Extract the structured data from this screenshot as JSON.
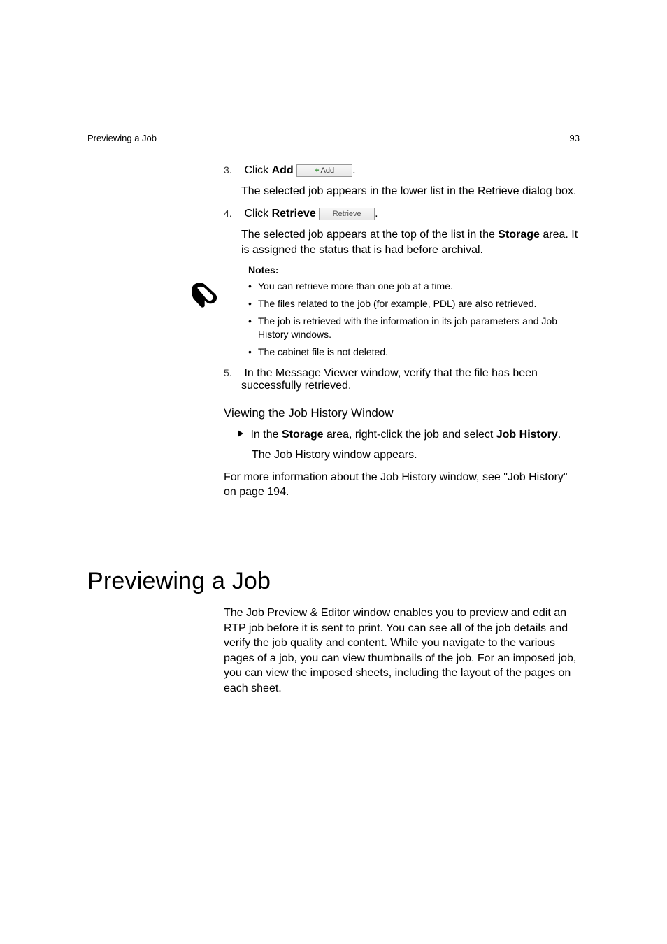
{
  "header": {
    "left": "Previewing a Job",
    "right": "93"
  },
  "steps": {
    "s3": {
      "num": "3.",
      "pre": "Click ",
      "bold": "Add",
      "btn_plus": "+",
      "btn_label": "Add",
      "post": ".",
      "cont": "The selected job appears in the lower list in the Retrieve dialog box."
    },
    "s4": {
      "num": "4.",
      "pre": "Click ",
      "bold": "Retrieve",
      "btn_label": "Retrieve",
      "post": ".",
      "cont_a": "The selected job appears at the top of the list in the ",
      "cont_bold": "Storage",
      "cont_b": " area. It is assigned the status that is had before archival."
    },
    "s5": {
      "num": "5.",
      "text": "In the Message Viewer window, verify that the file has been successfully retrieved."
    }
  },
  "notes": {
    "title": "Notes:",
    "items": [
      "You can retrieve more than one job at a time.",
      "The files related to the job (for example, PDL) are also retrieved.",
      "The job is retrieved with the information in its job parameters and Job History windows.",
      "The cabinet file is not deleted."
    ]
  },
  "viewing": {
    "heading": "Viewing the Job History Window",
    "line_a": "In the ",
    "bold1": "Storage",
    "line_b": " area, right-click the job and select ",
    "bold2": "Job History",
    "line_c": ".",
    "result": "The Job History window appears.",
    "more": "For more information about the Job History window, see \"Job History\" on page 194."
  },
  "section": {
    "title": "Previewing a Job",
    "para": "The Job Preview & Editor window enables you to preview and edit an RTP job before it is sent to print. You can see all of the job details and verify the job quality and content. While you navigate to the various pages of a job, you can view thumbnails of the job. For an imposed job, you can view the imposed sheets, including the layout of the pages on each sheet."
  }
}
